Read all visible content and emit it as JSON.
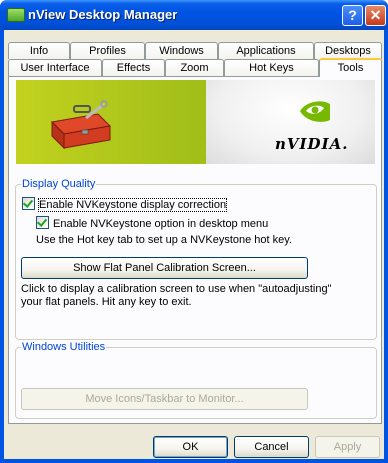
{
  "window": {
    "title": "nView Desktop Manager"
  },
  "titlebar": {
    "help_glyph": "?",
    "close_glyph": "✕"
  },
  "tabs": {
    "row1": [
      "Info",
      "Profiles",
      "Windows",
      "Applications",
      "Desktops"
    ],
    "row2": [
      "User Interface",
      "Effects",
      "Zoom",
      "Hot Keys",
      "Tools"
    ],
    "active": "Tools"
  },
  "banner": {
    "brand": "nVIDIA."
  },
  "display_quality": {
    "label": "Display Quality",
    "enable_keystone": {
      "label": "Enable NVKeystone display correction",
      "checked": true
    },
    "enable_menu_option": {
      "label": "Enable NVKeystone option in desktop menu",
      "checked": true
    },
    "hotkey_hint": "Use the Hot key tab to set up a NVKeystone hot key.",
    "calibration_button": "Show Flat Panel Calibration Screen...",
    "calibration_desc_line1": "Click to display a calibration screen to use when \"autoadjusting\"",
    "calibration_desc_line2": "your flat panels.  Hit any key to exit."
  },
  "windows_utilities": {
    "label": "Windows Utilities",
    "move_button": "Move Icons/Taskbar to Monitor..."
  },
  "footer": {
    "ok": "OK",
    "cancel": "Cancel",
    "apply": "Apply"
  },
  "colors": {
    "titlebar": "#0054e3",
    "group_label": "#0046d5",
    "active_tab_accent": "#ffc73c",
    "banner_green": "#a5c01a"
  }
}
